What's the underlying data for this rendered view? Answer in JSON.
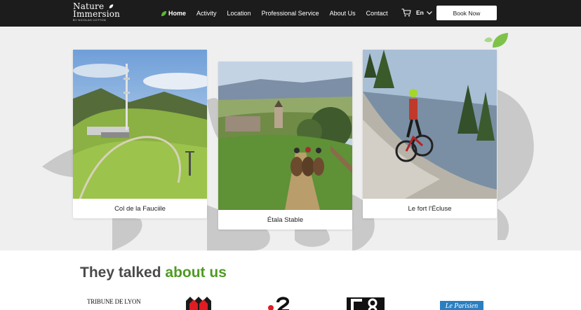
{
  "logo": {
    "line1": "Nature",
    "line2": "Immersion",
    "sub": "BY NICOLAS COTTON"
  },
  "nav": {
    "items": [
      {
        "label": "Home",
        "active": true
      },
      {
        "label": "Activity"
      },
      {
        "label": "Location"
      },
      {
        "label": "Professional Service"
      },
      {
        "label": "About Us"
      },
      {
        "label": "Contact"
      }
    ],
    "cart_icon": "cart-icon",
    "language": "En",
    "book_button": "Book Now"
  },
  "cards": [
    {
      "title": "Col de la Fauciile"
    },
    {
      "title": "Étala Stable"
    },
    {
      "title": "Le fort l'Écluse"
    }
  ],
  "press": {
    "title_main": "They talked",
    "title_accent": "about us",
    "logos": [
      "TRIBUNE DE LYON",
      "M6",
      "France 2",
      "C8",
      "Le Parisien"
    ]
  },
  "colors": {
    "nav_bg": "#1c1c1c",
    "accent_green": "#4f9a23",
    "hero_bg": "#efefef"
  }
}
